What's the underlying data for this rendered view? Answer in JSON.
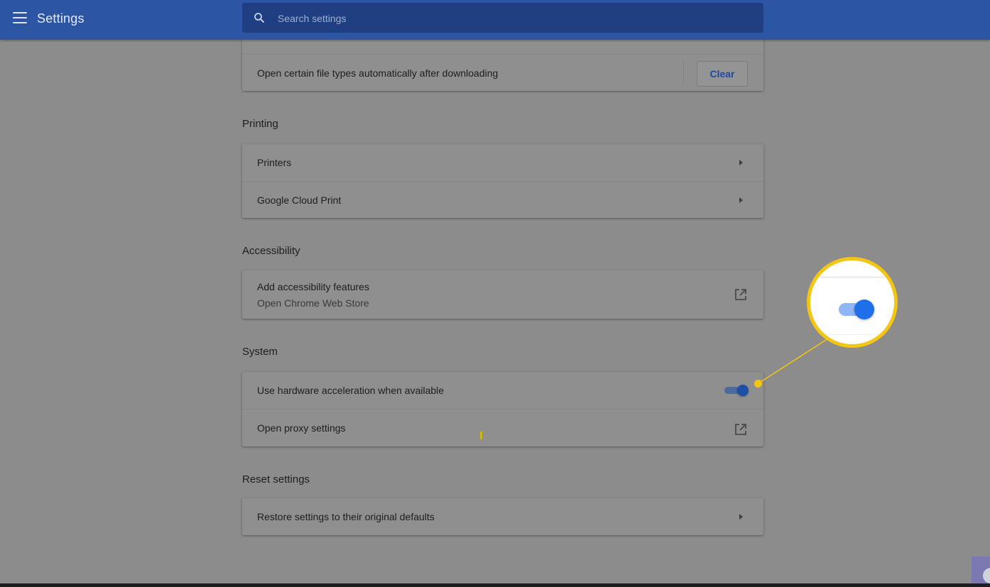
{
  "header": {
    "title": "Settings",
    "search_placeholder": "Search settings"
  },
  "downloads": {
    "auto_open_label": "Open certain file types automatically after downloading",
    "clear_button": "Clear"
  },
  "printing": {
    "title": "Printing",
    "items": [
      {
        "label": "Printers"
      },
      {
        "label": "Google Cloud Print"
      }
    ]
  },
  "accessibility": {
    "title": "Accessibility",
    "item_label": "Add accessibility features",
    "item_sublabel": "Open Chrome Web Store"
  },
  "system": {
    "title": "System",
    "hardware_acceleration_label": "Use hardware acceleration when available",
    "hardware_acceleration_enabled": true,
    "proxy_label": "Open proxy settings"
  },
  "reset": {
    "title": "Reset settings",
    "restore_label": "Restore settings to their original defaults"
  },
  "colors": {
    "header_bg": "#2c56a4",
    "overlay_gray": "#8c8c8c",
    "callout_yellow": "#f3c613",
    "toggle_blue": "#1f6fe8"
  },
  "icons": {
    "menu": "hamburger-menu-icon",
    "search": "search-icon",
    "arrow": "arrow-right-icon",
    "external": "open-in-new-icon"
  }
}
